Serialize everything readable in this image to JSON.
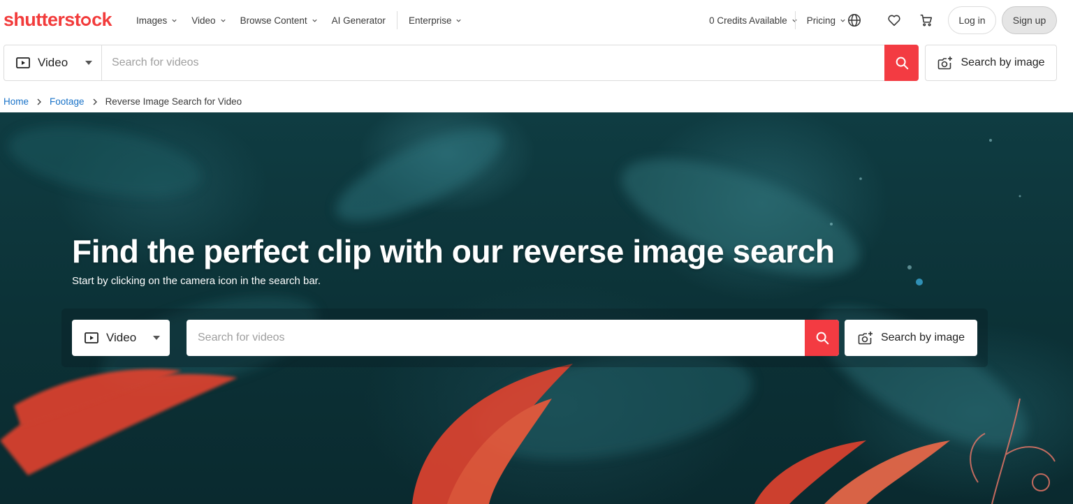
{
  "brand": {
    "logo_pre": "shutterst",
    "logo_post": "ck",
    "color": "#f23b3b"
  },
  "nav": {
    "left": [
      {
        "label": "Images",
        "has_dropdown": true
      },
      {
        "label": "Video",
        "has_dropdown": true
      },
      {
        "label": "Browse Content",
        "has_dropdown": true
      },
      {
        "label": "AI Generator",
        "has_dropdown": false
      },
      {
        "label": "Enterprise",
        "has_dropdown": true
      }
    ],
    "credits": "0 Credits Available",
    "pricing": "Pricing",
    "icons": [
      "globe-icon",
      "heart-icon",
      "cart-icon"
    ],
    "login": "Log in",
    "signup": "Sign up"
  },
  "search": {
    "media_type": "Video",
    "placeholder": "Search for videos",
    "value": "",
    "search_by_image": "Search by image",
    "button_color": "#f33b42"
  },
  "breadcrumb": {
    "home": "Home",
    "footage": "Footage",
    "current": "Reverse Image Search for Video"
  },
  "hero": {
    "title": "Find the perfect clip with our reverse image search",
    "subtitle": "Start by clicking on the camera icon in the search bar.",
    "search": {
      "media_type": "Video",
      "placeholder": "Search for videos",
      "search_by_image": "Search by image"
    },
    "image_description_colors": {
      "background": "#0f3c42",
      "leaf": "#e8432f"
    }
  }
}
